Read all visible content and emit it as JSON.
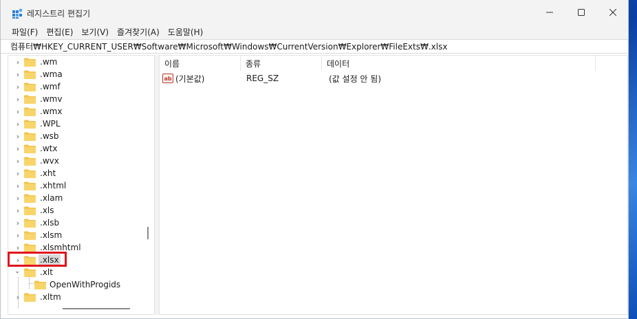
{
  "window": {
    "title": "레지스트리 편집기",
    "minimize_symbol": "—",
    "maximize_symbol": "☐",
    "close_symbol": "✕"
  },
  "menu": [
    "파일(F)",
    "편집(E)",
    "보기(V)",
    "즐겨찾기(A)",
    "도움말(H)"
  ],
  "address": {
    "path": "컴퓨터₩HKEY_CURRENT_USER₩Software₩Microsoft₩Windows₩CurrentVersion₩Explorer₩FileExts₩.xlsx"
  },
  "tree": {
    "items": [
      {
        "label": ".wm",
        "expander": "collapsed"
      },
      {
        "label": ".wma",
        "expander": "collapsed"
      },
      {
        "label": ".wmf",
        "expander": "collapsed"
      },
      {
        "label": ".wmv",
        "expander": "collapsed"
      },
      {
        "label": ".wmx",
        "expander": "collapsed"
      },
      {
        "label": ".WPL",
        "expander": "collapsed"
      },
      {
        "label": ".wsb",
        "expander": "collapsed"
      },
      {
        "label": ".wtx",
        "expander": "collapsed"
      },
      {
        "label": ".wvx",
        "expander": "collapsed"
      },
      {
        "label": ".xht",
        "expander": "collapsed"
      },
      {
        "label": ".xhtml",
        "expander": "collapsed"
      },
      {
        "label": ".xlam",
        "expander": "collapsed"
      },
      {
        "label": ".xls",
        "expander": "collapsed"
      },
      {
        "label": ".xlsb",
        "expander": "collapsed"
      },
      {
        "label": ".xlsm",
        "expander": "collapsed"
      },
      {
        "label": ".xlsmhtml",
        "expander": "collapsed"
      },
      {
        "label": ".xlsx",
        "expander": "collapsed",
        "selected": true
      },
      {
        "label": ".xlt",
        "expander": "expanded"
      },
      {
        "label": "OpenWithProgids",
        "expander": "none",
        "child": true
      },
      {
        "label": ".xltm",
        "expander": "collapsed"
      }
    ]
  },
  "list": {
    "columns": [
      "이름",
      "종류",
      "데이터"
    ],
    "rows": [
      {
        "icon": "ab",
        "name": "(기본값)",
        "type": "REG_SZ",
        "data": "(값 설정 안 됨)"
      }
    ]
  },
  "colors": {
    "selection_highlight": "#e0141e",
    "folder": "#f3c34b",
    "window_chrome": "#f3f3f3"
  }
}
